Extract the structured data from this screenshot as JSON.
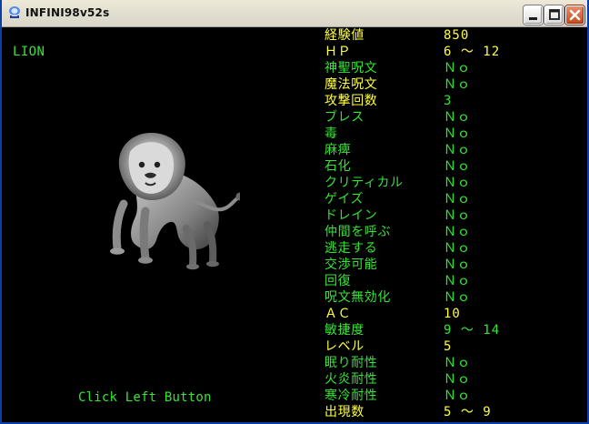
{
  "window": {
    "title": "INFINI98v52s",
    "controls": {
      "minimize_icon": "minimize-icon",
      "maximize_icon": "maximize-icon",
      "close_icon": "close-icon"
    }
  },
  "monster": {
    "name": "LION",
    "art_icon": "lion-image",
    "hint": "Click Left Button"
  },
  "colors": {
    "window_frame": "#0A3EA8",
    "background": "#000000",
    "label_yellow": "#FFFF3C",
    "label_green": "#33E533"
  },
  "stats": [
    {
      "label": "経験値",
      "value": "850",
      "color": "yellow"
    },
    {
      "label": "ＨＰ",
      "value": "6  ～  12",
      "color": "yellow"
    },
    {
      "label": "神聖呪文",
      "value": "Ｎｏ",
      "color": "green"
    },
    {
      "label": "魔法呪文",
      "value": "Ｎｏ",
      "color": "yellow"
    },
    {
      "label": "攻撃回数",
      "value": "3",
      "color": "yellow"
    },
    {
      "label": "ブレス",
      "value": "Ｎｏ",
      "color": "green"
    },
    {
      "label": "毒",
      "value": "Ｎｏ",
      "color": "green"
    },
    {
      "label": "麻痺",
      "value": "Ｎｏ",
      "color": "green"
    },
    {
      "label": "石化",
      "value": "Ｎｏ",
      "color": "green"
    },
    {
      "label": "クリティカル",
      "value": "Ｎｏ",
      "color": "green"
    },
    {
      "label": "ゲイズ",
      "value": "Ｎｏ",
      "color": "green"
    },
    {
      "label": "ドレイン",
      "value": "Ｎｏ",
      "color": "green"
    },
    {
      "label": "仲間を呼ぶ",
      "value": "Ｎｏ",
      "color": "green"
    },
    {
      "label": "逃走する",
      "value": "Ｎｏ",
      "color": "green"
    },
    {
      "label": "交渉可能",
      "value": "Ｎｏ",
      "color": "green"
    },
    {
      "label": "回復",
      "value": "Ｎｏ",
      "color": "green"
    },
    {
      "label": "呪文無効化",
      "value": "Ｎｏ",
      "color": "green"
    },
    {
      "label": "ＡＣ",
      "value": "10",
      "color": "yellow"
    },
    {
      "label": "敏捷度",
      "value": "9  ～  14",
      "color": "green"
    },
    {
      "label": "レベル",
      "value": "5",
      "color": "yellow"
    },
    {
      "label": "眠り耐性",
      "value": "Ｎｏ",
      "color": "green"
    },
    {
      "label": "火炎耐性",
      "value": "Ｎｏ",
      "color": "green"
    },
    {
      "label": "寒冷耐性",
      "value": "Ｎｏ",
      "color": "green"
    },
    {
      "label": "出現数",
      "value": "5  ～  9",
      "color": "yellow"
    }
  ]
}
